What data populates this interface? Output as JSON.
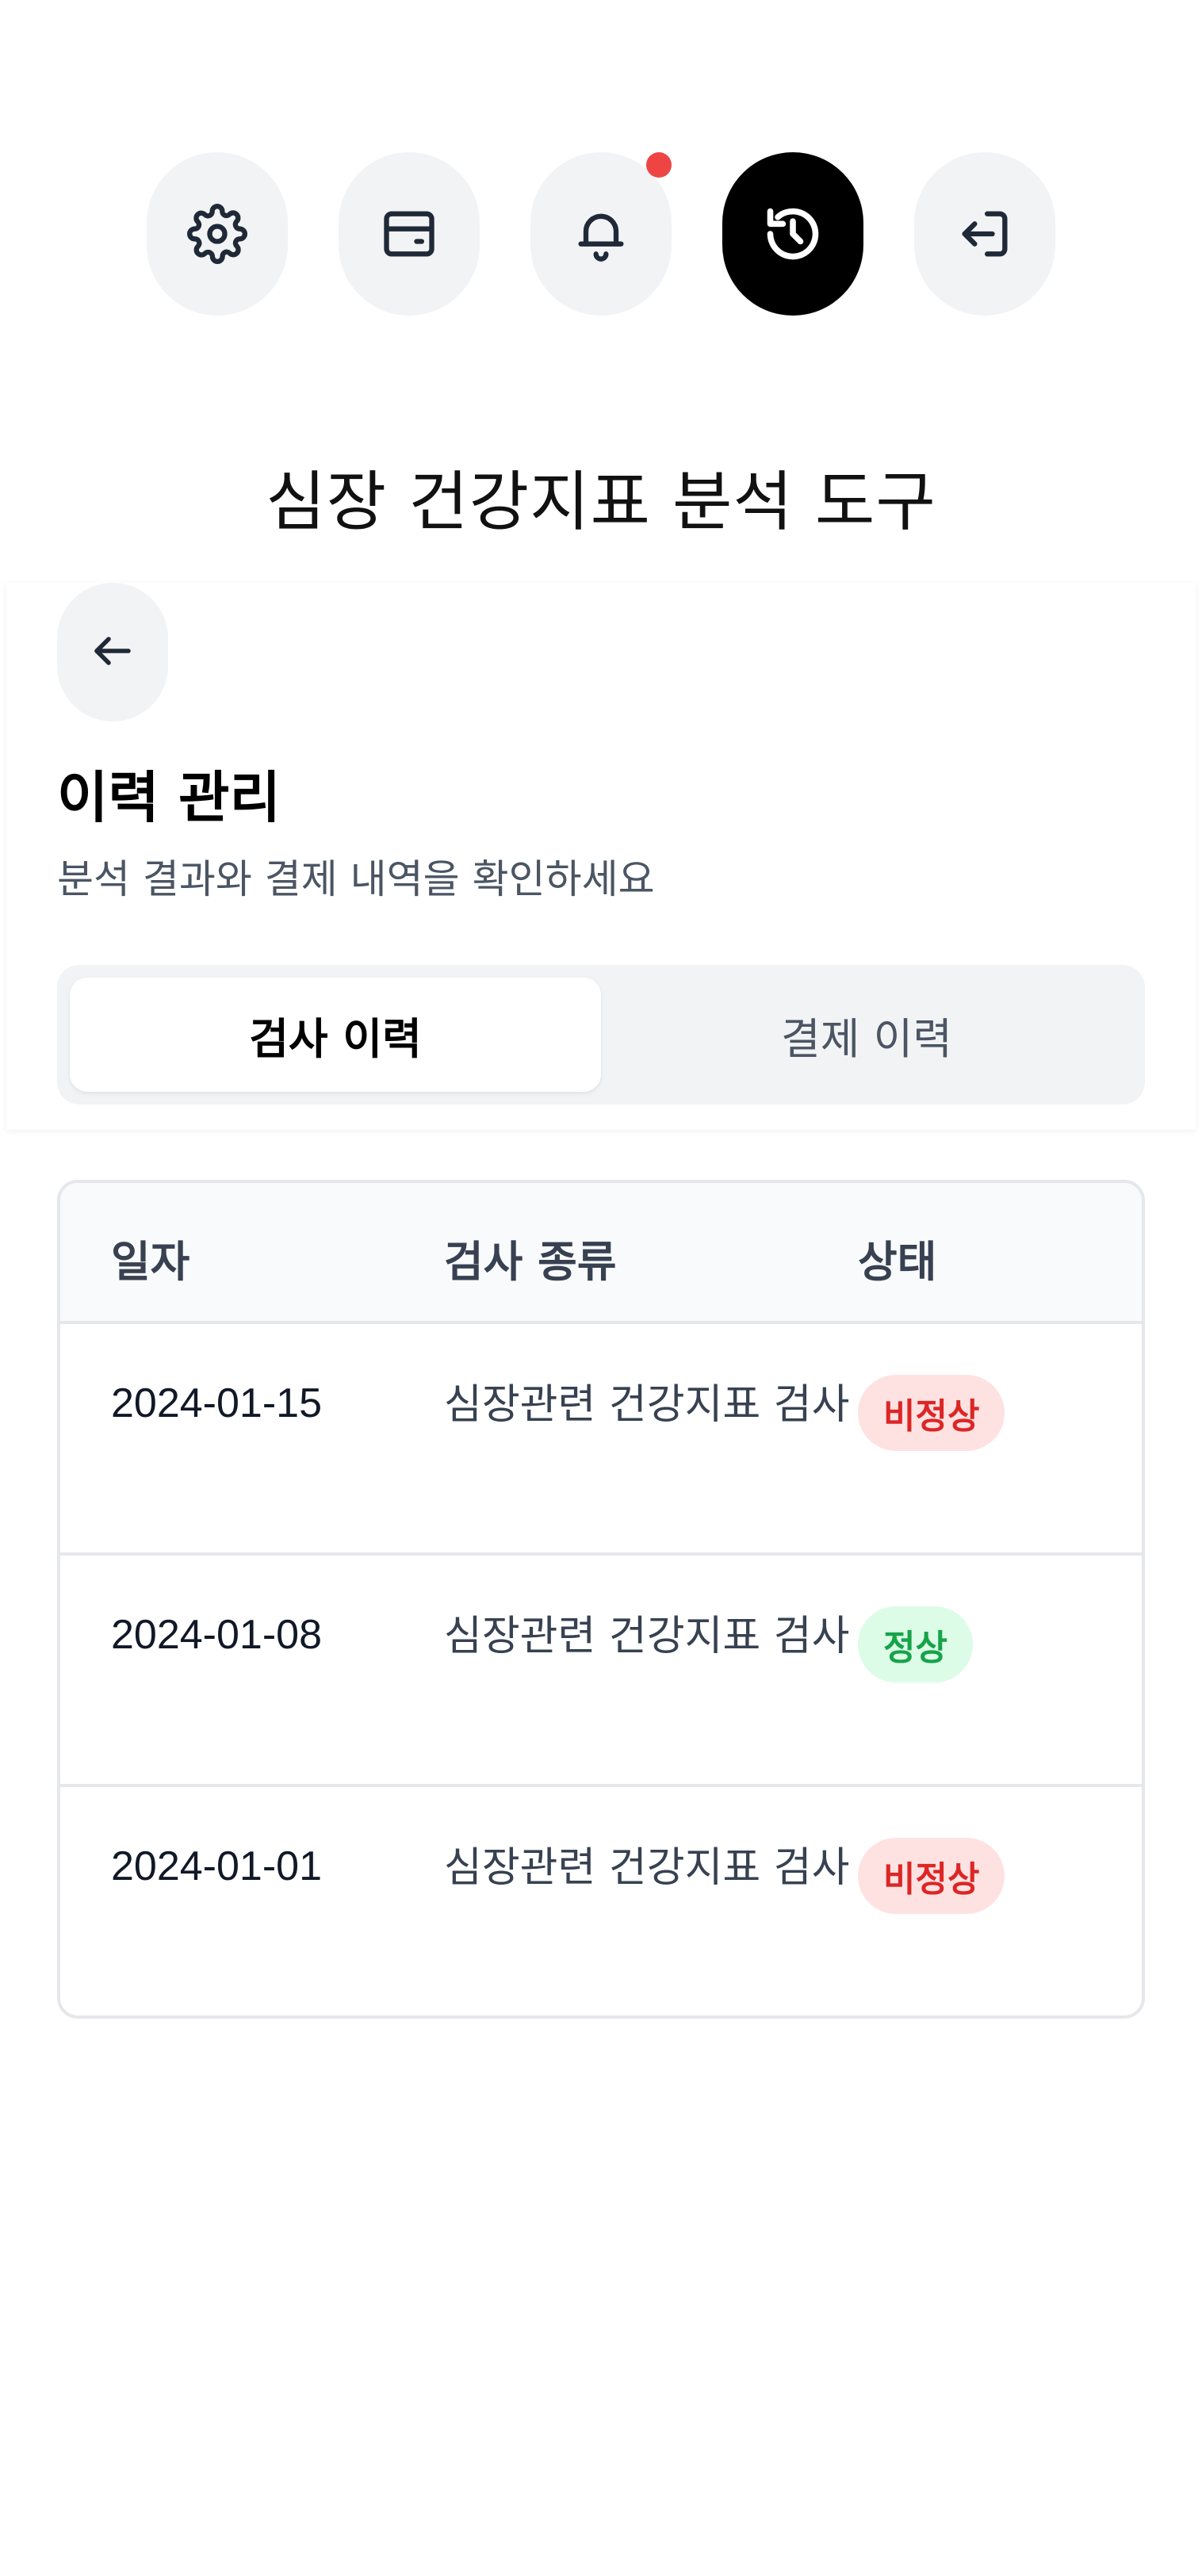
{
  "toolbar": {
    "icons": [
      {
        "name": "settings-icon",
        "active": false
      },
      {
        "name": "payment-card-icon",
        "active": false
      },
      {
        "name": "bell-icon",
        "active": false,
        "notification": true
      },
      {
        "name": "history-icon",
        "active": true
      },
      {
        "name": "logout-icon",
        "active": false
      }
    ],
    "notification_color": "#ef4444"
  },
  "app": {
    "title": "심장 건강지표 분석 도구"
  },
  "history": {
    "back_icon": "arrow-left-icon",
    "title": "이력 관리",
    "subtitle": "분석 결과와 결제 내역을 확인하세요",
    "tabs": [
      {
        "label": "검사 이력",
        "active": true
      },
      {
        "label": "결제 이력",
        "active": false
      }
    ]
  },
  "table": {
    "headers": [
      "일자",
      "검사 종류",
      "상태"
    ],
    "rows": [
      {
        "date": "2024-01-15",
        "type": "심장관련 건강지표 검사",
        "status": "비정상",
        "status_kind": "abnormal"
      },
      {
        "date": "2024-01-08",
        "type": "심장관련 건강지표 검사",
        "status": "정상",
        "status_kind": "normal"
      },
      {
        "date": "2024-01-01",
        "type": "심장관련 건강지표 검사",
        "status": "비정상",
        "status_kind": "abnormal"
      }
    ]
  },
  "colors": {
    "abnormal_bg": "#fee2e2",
    "abnormal_text": "#dc2626",
    "normal_bg": "#dcfce7",
    "normal_text": "#16a34a",
    "active_nav": "#000000"
  }
}
